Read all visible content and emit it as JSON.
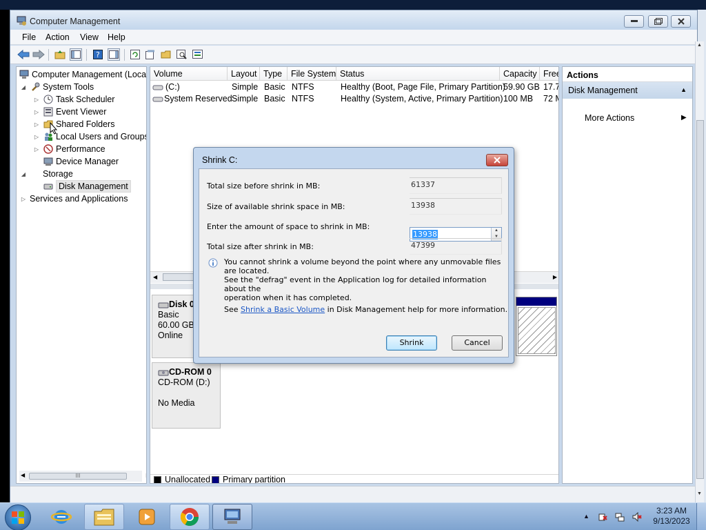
{
  "window": {
    "title": "Computer Management",
    "menu": [
      "File",
      "Action",
      "View",
      "Help"
    ],
    "toolbar_icons": [
      "back-arrow-icon",
      "forward-arrow-icon",
      "up-folder-icon",
      "show-hide-tree-icon",
      "help-icon",
      "show-hide-action-pane-icon",
      "refresh-icon",
      "properties-icon",
      "open-icon",
      "search-icon",
      "disk-settings-icon"
    ]
  },
  "tree": {
    "items": [
      {
        "label": "Computer Management (Local",
        "icon": "computer-management-icon",
        "expander": ""
      },
      {
        "label": "System Tools",
        "icon": "system-tools-icon",
        "expander": "◢"
      },
      {
        "label": "Task Scheduler",
        "icon": "clock-icon",
        "expander": "▷"
      },
      {
        "label": "Event Viewer",
        "icon": "event-viewer-icon",
        "expander": "▷"
      },
      {
        "label": "Shared Folders",
        "icon": "shared-folder-icon",
        "expander": "▷"
      },
      {
        "label": "Local Users and Groups",
        "icon": "users-icon",
        "expander": "▷"
      },
      {
        "label": "Performance",
        "icon": "performance-icon",
        "expander": "▷"
      },
      {
        "label": "Device Manager",
        "icon": "device-manager-icon",
        "expander": ""
      },
      {
        "label": "Storage",
        "icon": "storage-icon",
        "expander": "◢"
      },
      {
        "label": "Disk Management",
        "icon": "disk-icon",
        "expander": ""
      },
      {
        "label": "Services and Applications",
        "icon": "services-icon",
        "expander": "▷"
      }
    ],
    "scroll_thumb_glyph": "III"
  },
  "volumes": {
    "columns": [
      "Volume",
      "Layout",
      "Type",
      "File System",
      "Status",
      "Capacity",
      "Free"
    ],
    "rows": [
      [
        "(C:)",
        "Simple",
        "Basic",
        "NTFS",
        "Healthy (Boot, Page File, Primary Partition)",
        "59.90 GB",
        "17.7"
      ],
      [
        "System Reserved",
        "Simple",
        "Basic",
        "NTFS",
        "Healthy (System, Active, Primary Partition)",
        "100 MB",
        "72 M"
      ]
    ]
  },
  "disks": {
    "disk0": {
      "name": "Disk 0",
      "type": "Basic",
      "size": "60.00 GB",
      "state": "Online"
    },
    "cdrom": {
      "name": "CD-ROM 0",
      "drive": "CD-ROM (D:)",
      "media": "No Media"
    }
  },
  "legend": {
    "unallocated": "Unallocated",
    "primary": "Primary partition",
    "unallocated_color": "#000000",
    "primary_color": "#00007f"
  },
  "actions": {
    "header": "Actions",
    "section": "Disk Management",
    "more": "More Actions"
  },
  "dialog": {
    "title": "Shrink C:",
    "fields": [
      {
        "label": "Total size before shrink in MB:",
        "value": "61337"
      },
      {
        "label": "Size of available shrink space in MB:",
        "value": "13938"
      },
      {
        "label": "Enter the amount of space to shrink in MB:",
        "value": "13938"
      },
      {
        "label": "Total size after shrink in MB:",
        "value": "47399"
      }
    ],
    "info_lines": [
      "You cannot shrink a volume beyond the point where any unmovable files are located.",
      "See the \"defrag\" event in the Application log for detailed information about the",
      "operation when it has completed."
    ],
    "see_prefix": "See ",
    "see_link": "Shrink a Basic Volume",
    "see_suffix": " in Disk Management help for more information.",
    "shrink_button": "Shrink",
    "cancel_button": "Cancel"
  },
  "taskbar": {
    "apps": [
      "internet-explorer-icon",
      "file-explorer-icon",
      "media-player-icon",
      "chrome-icon",
      "computer-management-icon"
    ],
    "time": "3:23 AM",
    "date": "9/13/2023"
  },
  "colors": {
    "accent": "#3399ff",
    "link": "#1a56c5",
    "primary_partition": "#00007f"
  }
}
